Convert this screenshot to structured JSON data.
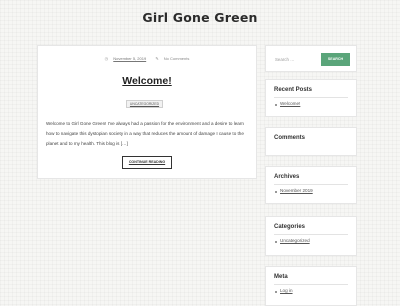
{
  "site": {
    "title": "Girl Gone Green"
  },
  "post": {
    "date": "November 5, 2019",
    "comments": "No Comments",
    "title": "Welcome!",
    "category": "UNCATEGORIZED",
    "excerpt": "Welcome to Girl Gone Green! I've always had a passion for the environment and a desire to learn how to navigate this dystopian society in a way that reduces the amount of damage I cause to the planet and to my health. This blog is […]",
    "continue_label": "CONTINUE READING"
  },
  "sidebar": {
    "search": {
      "placeholder": "Search …",
      "button_label": "SEARCH"
    },
    "recent_posts": {
      "title": "Recent Posts",
      "items": [
        "Welcome!"
      ]
    },
    "comments": {
      "title": "Comments"
    },
    "archives": {
      "title": "Archives",
      "items": [
        "November 2019"
      ]
    },
    "categories": {
      "title": "Categories",
      "items": [
        "Uncategorized"
      ]
    },
    "meta": {
      "title": "Meta",
      "items": [
        "Log in"
      ]
    }
  },
  "colors": {
    "accent": "#5aa57a",
    "background": "#f6f6f4",
    "card": "#ffffff"
  },
  "icons": {
    "date": "clock-icon",
    "comments": "comment-icon"
  }
}
